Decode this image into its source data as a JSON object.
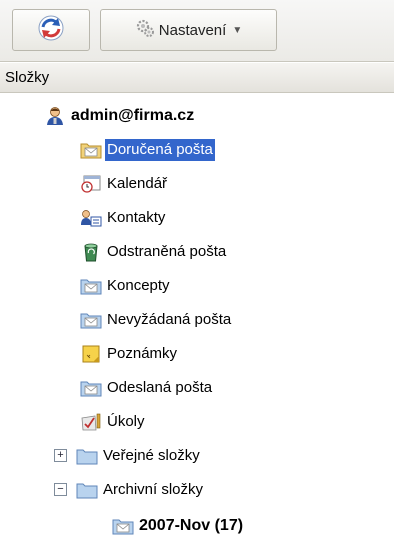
{
  "toolbar": {
    "settings_label": "Nastavení"
  },
  "panel": {
    "header": "Složky"
  },
  "tree": {
    "account": "admin@firma.cz",
    "items": [
      {
        "label": "Doručená pošta",
        "icon": "inbox-folder-icon",
        "selected": true
      },
      {
        "label": "Kalendář",
        "icon": "calendar-icon"
      },
      {
        "label": "Kontakty",
        "icon": "contacts-icon"
      },
      {
        "label": "Odstraněná pošta",
        "icon": "recycle-bin-icon"
      },
      {
        "label": "Koncepty",
        "icon": "drafts-folder-icon"
      },
      {
        "label": "Nevyžádaná pošta",
        "icon": "junk-folder-icon"
      },
      {
        "label": "Poznámky",
        "icon": "notes-icon"
      },
      {
        "label": "Odeslaná pošta",
        "icon": "sent-folder-icon"
      },
      {
        "label": "Úkoly",
        "icon": "tasks-icon"
      }
    ],
    "public": {
      "label": "Veřejné složky",
      "toggle": "+"
    },
    "archive": {
      "label": "Archivní složky",
      "toggle": "−"
    },
    "archive_child": {
      "label": "2007-Nov (17)"
    }
  },
  "colors": {
    "selection": "#3366cc",
    "folder": "#f1d27a"
  }
}
